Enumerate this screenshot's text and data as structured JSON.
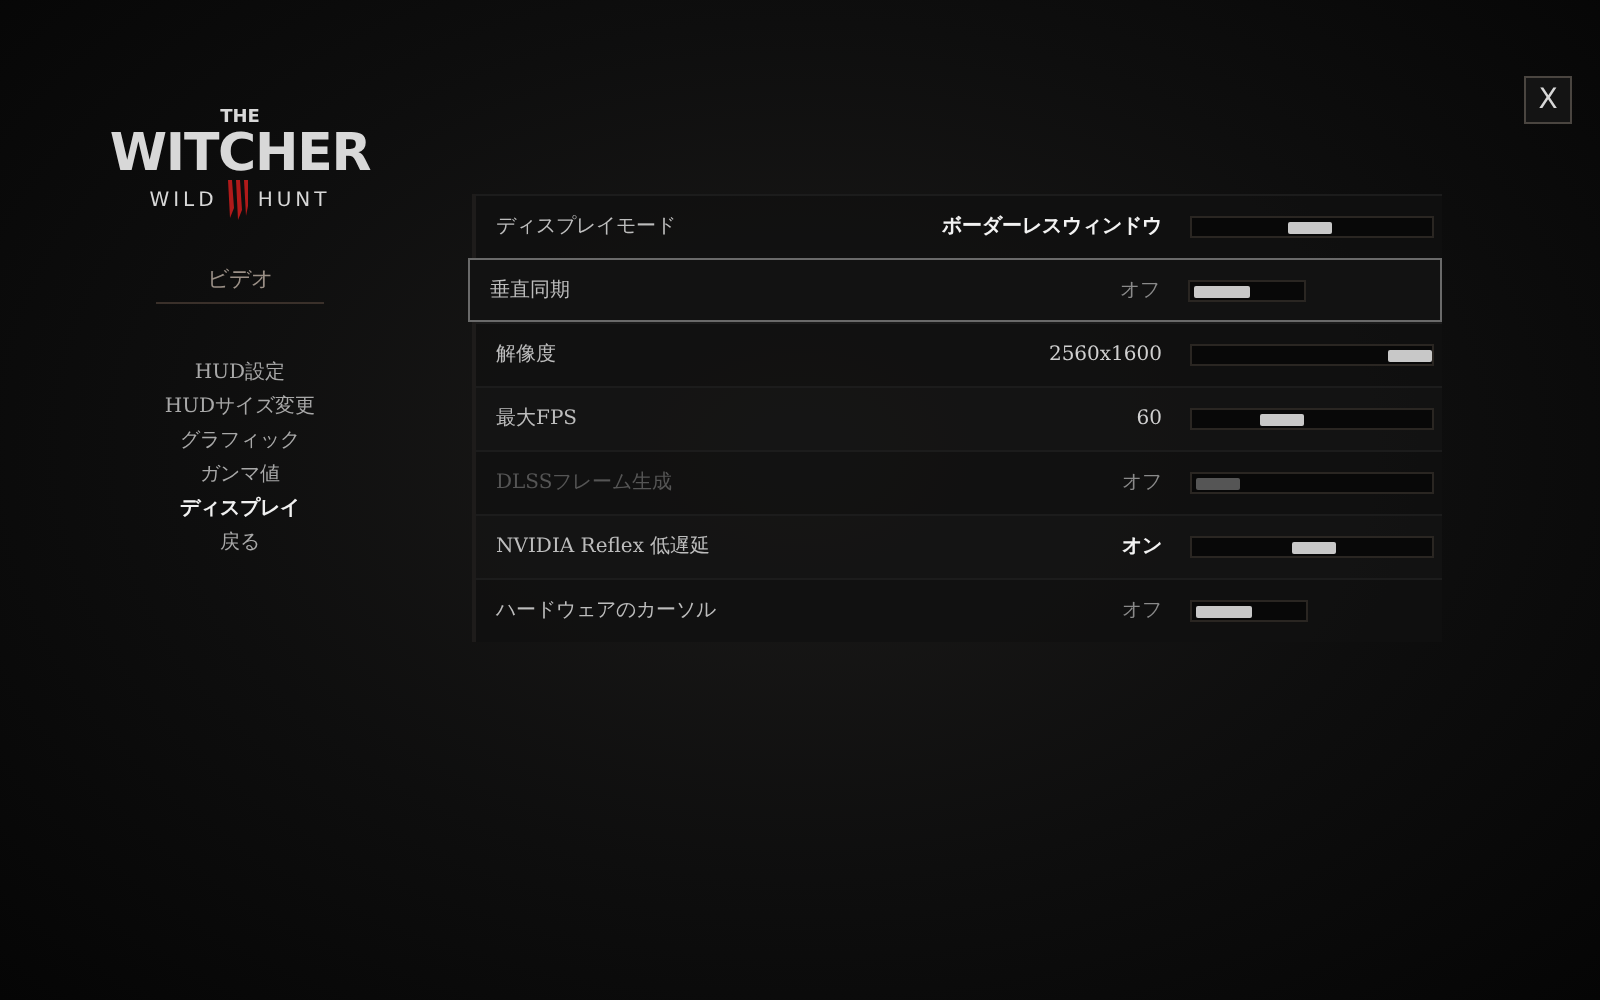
{
  "logo": {
    "top": "THE",
    "title": "WITCHER",
    "left": "WILD",
    "right": "HUNT"
  },
  "section": {
    "title": "ビデオ"
  },
  "menu": [
    {
      "label": "HUD設定",
      "selected": false
    },
    {
      "label": "HUDサイズ変更",
      "selected": false
    },
    {
      "label": "グラフィック",
      "selected": false
    },
    {
      "label": "ガンマ値",
      "selected": false
    },
    {
      "label": "ディスプレイ",
      "selected": true
    },
    {
      "label": "戻る",
      "selected": false
    }
  ],
  "close_button": {
    "label": "X"
  },
  "settings": [
    {
      "label": "ディスプレイモード",
      "value": "ボーダーレスウィンドウ",
      "kind": "selector",
      "level": 0.48,
      "selected": false,
      "disabled": false,
      "emphasized": true
    },
    {
      "label": "垂直同期",
      "value": "オフ",
      "kind": "toggle",
      "on": false,
      "selected": true,
      "disabled": false,
      "emphasized": false,
      "dimmed": true
    },
    {
      "label": "解像度",
      "value": "2560x1600",
      "kind": "selector",
      "level": 1,
      "selected": false,
      "disabled": false,
      "emphasized": false,
      "dimmed": false
    },
    {
      "label": "最大FPS",
      "value": "60",
      "kind": "selector",
      "level": 0.33,
      "selected": false,
      "disabled": false,
      "emphasized": false,
      "dimmed": false
    },
    {
      "label": "DLSSフレーム生成",
      "value": "オフ",
      "kind": "selector",
      "level": 0,
      "selected": false,
      "disabled": true,
      "emphasized": false,
      "dimmed": true
    },
    {
      "label": "NVIDIA Reflex 低遅延",
      "value": "オン",
      "kind": "selector",
      "level": 0.5,
      "selected": false,
      "disabled": false,
      "emphasized": true
    },
    {
      "label": "ハードウェアのカーソル",
      "value": "オフ",
      "kind": "toggle",
      "on": false,
      "selected": false,
      "disabled": false,
      "emphasized": false,
      "dimmed": true
    }
  ]
}
